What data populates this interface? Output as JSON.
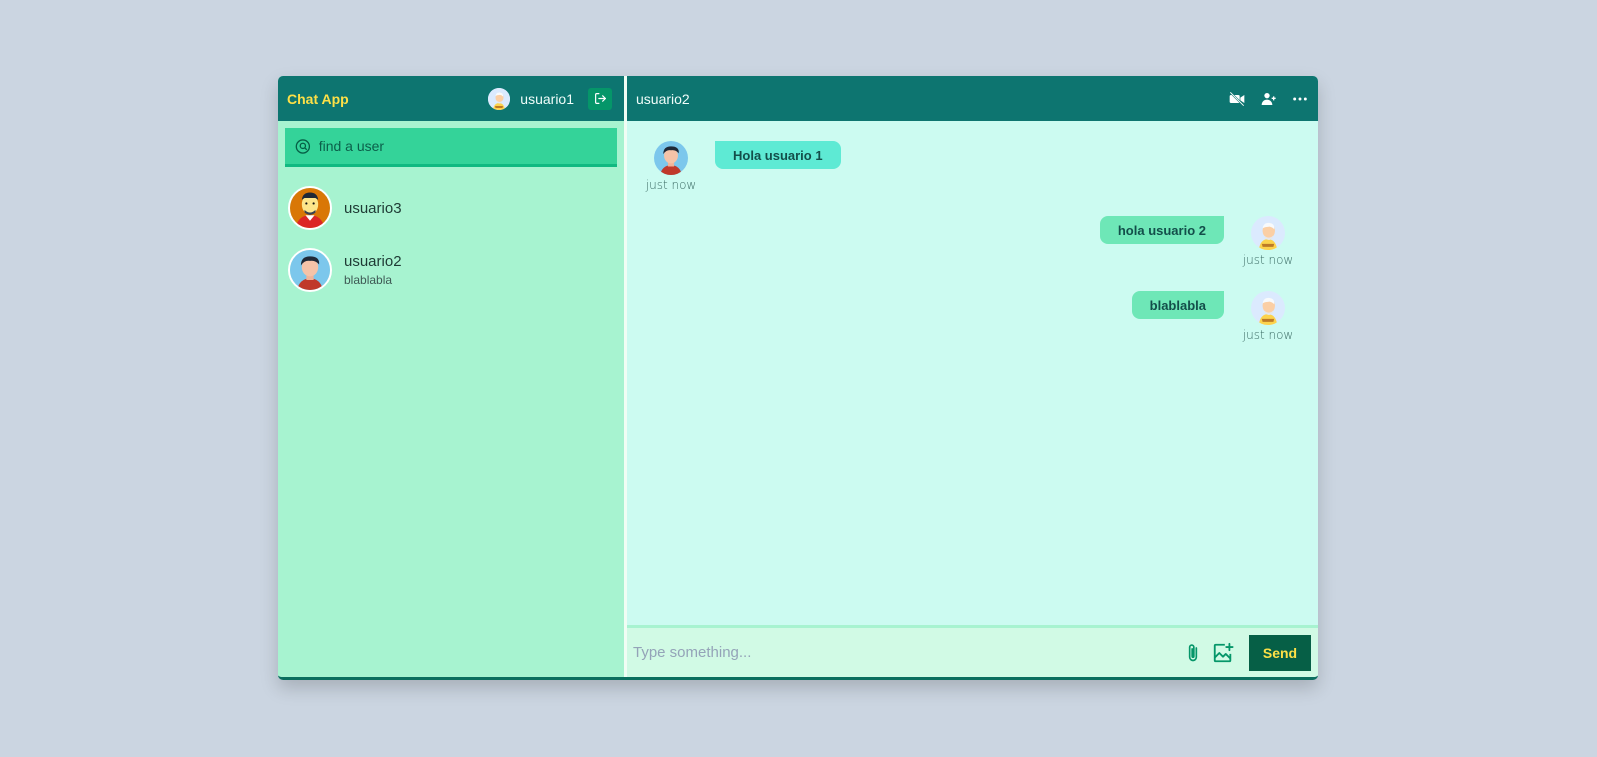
{
  "app": {
    "brand": "Chat App"
  },
  "current_user": {
    "name": "usuario1"
  },
  "search": {
    "placeholder": "find a user"
  },
  "users": [
    {
      "name": "usuario3",
      "last_message": ""
    },
    {
      "name": "usuario2",
      "last_message": "blablabla"
    }
  ],
  "chat": {
    "title": "usuario2",
    "messages": [
      {
        "text": "Hola usuario 1",
        "time": "just now",
        "direction": "incoming"
      },
      {
        "text": "hola usuario 2",
        "time": "just now",
        "direction": "outgoing"
      },
      {
        "text": "blablabla",
        "time": "just now",
        "direction": "outgoing"
      }
    ]
  },
  "composer": {
    "placeholder": "Type something...",
    "send_label": "Send"
  },
  "icons": {
    "logout": "logout-icon",
    "search": "search-icon",
    "video": "video-off-icon",
    "add_user": "add-user-icon",
    "more": "more-icon",
    "attach": "paperclip-icon",
    "image": "add-image-icon"
  },
  "colors": {
    "header": "#0d7570",
    "sidebar": "#a7f3d0",
    "chat_bg": "#ccfbf1",
    "brand": "#fde047",
    "send": "#065f46"
  }
}
